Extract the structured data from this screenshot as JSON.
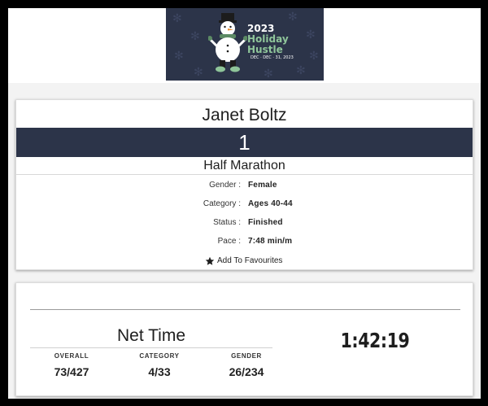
{
  "banner": {
    "year": "2023",
    "name_line1": "Holiday",
    "name_line2": "Hustle",
    "dates": "DEC · DEC · 31, 2023",
    "icon": "snowman-icon",
    "background": "#2c3449"
  },
  "runner": {
    "name": "Janet Boltz",
    "bib": "1",
    "race": "Half Marathon"
  },
  "details": [
    {
      "label": "Gender :",
      "value": "Female"
    },
    {
      "label": "Category :",
      "value": "Ages 40-44"
    },
    {
      "label": "Status :",
      "value": "Finished"
    },
    {
      "label": "Pace :",
      "value": "7:48 min/m"
    }
  ],
  "favourite": {
    "label": "Add To Favourites",
    "icon": "star-icon"
  },
  "result": {
    "title": "Net Time",
    "time": "1:42:19",
    "rankings": [
      {
        "label": "OVERALL",
        "value": "73/427"
      },
      {
        "label": "CATEGORY",
        "value": "4/33"
      },
      {
        "label": "GENDER",
        "value": "26/234"
      }
    ]
  },
  "colors": {
    "accent": "#2c3449",
    "page_background": "#f3f3f3"
  }
}
